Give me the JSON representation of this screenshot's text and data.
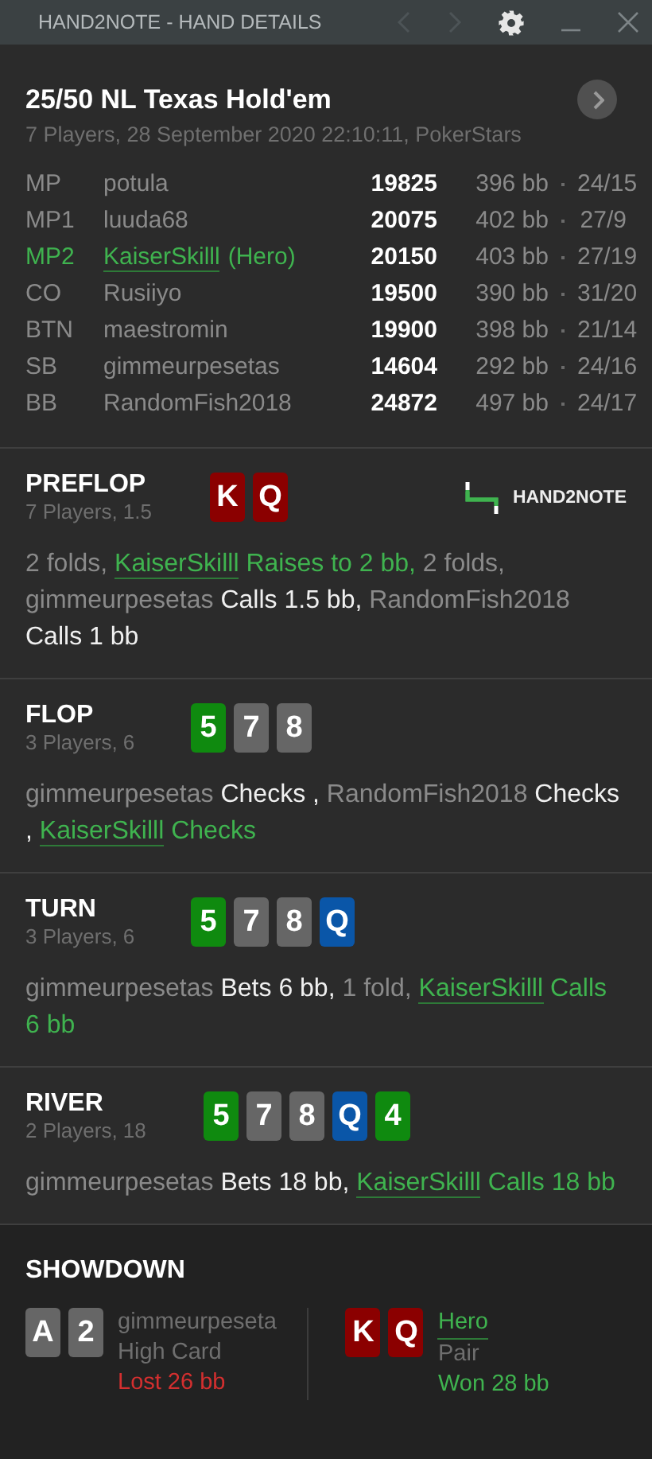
{
  "window": {
    "title": "HAND2NOTE - HAND DETAILS"
  },
  "hand": {
    "title": "25/50 NL Texas Hold'em",
    "subtitle": "7 Players, 28 September 2020 22:10:11, PokerStars"
  },
  "players": [
    {
      "position": "MP",
      "name": "potula",
      "hero": false,
      "stack": "19825",
      "bb": "396 bb",
      "ratio": "24/15"
    },
    {
      "position": "MP1",
      "name": "luuda68",
      "hero": false,
      "stack": "20075",
      "bb": "402 bb",
      "ratio": "27/9"
    },
    {
      "position": "MP2",
      "name": "KaiserSkilll",
      "hero": true,
      "suffix": "(Hero)",
      "stack": "20150",
      "bb": "403 bb",
      "ratio": "27/19"
    },
    {
      "position": "CO",
      "name": "Rusiiyo",
      "hero": false,
      "stack": "19500",
      "bb": "390 bb",
      "ratio": "31/20"
    },
    {
      "position": "BTN",
      "name": "maestromin",
      "hero": false,
      "stack": "19900",
      "bb": "398 bb",
      "ratio": "21/14"
    },
    {
      "position": "SB",
      "name": "gimmeurpesetas",
      "hero": false,
      "stack": "14604",
      "bb": "292 bb",
      "ratio": "24/16"
    },
    {
      "position": "BB",
      "name": "RandomFish2018",
      "hero": false,
      "stack": "24872",
      "bb": "497 bb",
      "ratio": "24/17"
    }
  ],
  "streets": [
    {
      "name": "PREFLOP",
      "info": "7 Players, 1.5",
      "logo": "HAND2NOTE",
      "cards": [
        {
          "rank": "K",
          "color": "#8b0000"
        },
        {
          "rank": "Q",
          "color": "#8b0000"
        }
      ],
      "actions": [
        {
          "kind": "plain",
          "text": "2 folds, "
        },
        {
          "kind": "hero",
          "text": "KaiserSkilll"
        },
        {
          "kind": "hero_action",
          "text": " Raises to 2 bb,"
        },
        {
          "kind": "plain",
          "text": " 2 folds, gimmeurpesetas"
        },
        {
          "kind": "action",
          "text": " Calls 1.5 bb,"
        },
        {
          "kind": "plain",
          "text": " RandomFish2018"
        },
        {
          "kind": "action",
          "text": " Calls 1 bb"
        }
      ]
    },
    {
      "name": "FLOP",
      "info": "3 Players, 6",
      "cards": [
        {
          "rank": "5",
          "color": "#0f8a0f"
        },
        {
          "rank": "7",
          "color": "#666666"
        },
        {
          "rank": "8",
          "color": "#666666"
        }
      ],
      "actions": [
        {
          "kind": "plain",
          "text": "gimmeurpesetas"
        },
        {
          "kind": "action",
          "text": " Checks ,"
        },
        {
          "kind": "plain",
          "text": " RandomFish2018"
        },
        {
          "kind": "action",
          "text": " Checks , "
        },
        {
          "kind": "hero",
          "text": "KaiserSkilll"
        },
        {
          "kind": "hero_action",
          "text": " Checks"
        }
      ]
    },
    {
      "name": "TURN",
      "info": "3 Players, 6",
      "cards": [
        {
          "rank": "5",
          "color": "#0f8a0f"
        },
        {
          "rank": "7",
          "color": "#666666"
        },
        {
          "rank": "8",
          "color": "#666666"
        },
        {
          "rank": "Q",
          "color": "#0a56a8"
        }
      ],
      "actions": [
        {
          "kind": "plain",
          "text": "gimmeurpesetas"
        },
        {
          "kind": "action",
          "text": " Bets 6 bb,"
        },
        {
          "kind": "plain",
          "text": " 1 fold, "
        },
        {
          "kind": "hero",
          "text": "KaiserSkilll"
        },
        {
          "kind": "hero_action",
          "text": " Calls 6 bb"
        }
      ]
    },
    {
      "name": "RIVER",
      "info": "2 Players, 18",
      "cards": [
        {
          "rank": "5",
          "color": "#0f8a0f"
        },
        {
          "rank": "7",
          "color": "#666666"
        },
        {
          "rank": "8",
          "color": "#666666"
        },
        {
          "rank": "Q",
          "color": "#0a56a8"
        },
        {
          "rank": "4",
          "color": "#0f8a0f"
        }
      ],
      "actions": [
        {
          "kind": "plain",
          "text": "gimmeurpesetas"
        },
        {
          "kind": "action",
          "text": " Bets 18 bb, "
        },
        {
          "kind": "hero",
          "text": "KaiserSkilll"
        },
        {
          "kind": "hero_action",
          "text": " Calls 18 bb"
        }
      ]
    }
  ],
  "showdown": {
    "title": "SHOWDOWN",
    "hands": [
      {
        "name": "gimmeurpeseta",
        "hero": false,
        "hand": "High Card",
        "result": "Lost 26 bb",
        "won": false,
        "cards": [
          {
            "rank": "A",
            "color": "#666666"
          },
          {
            "rank": "2",
            "color": "#666666"
          }
        ]
      },
      {
        "name": "Hero",
        "hero": true,
        "hand": "Pair",
        "result": "Won 28 bb",
        "won": true,
        "cards": [
          {
            "rank": "K",
            "color": "#8b0000"
          },
          {
            "rank": "Q",
            "color": "#8b0000"
          }
        ]
      }
    ]
  }
}
